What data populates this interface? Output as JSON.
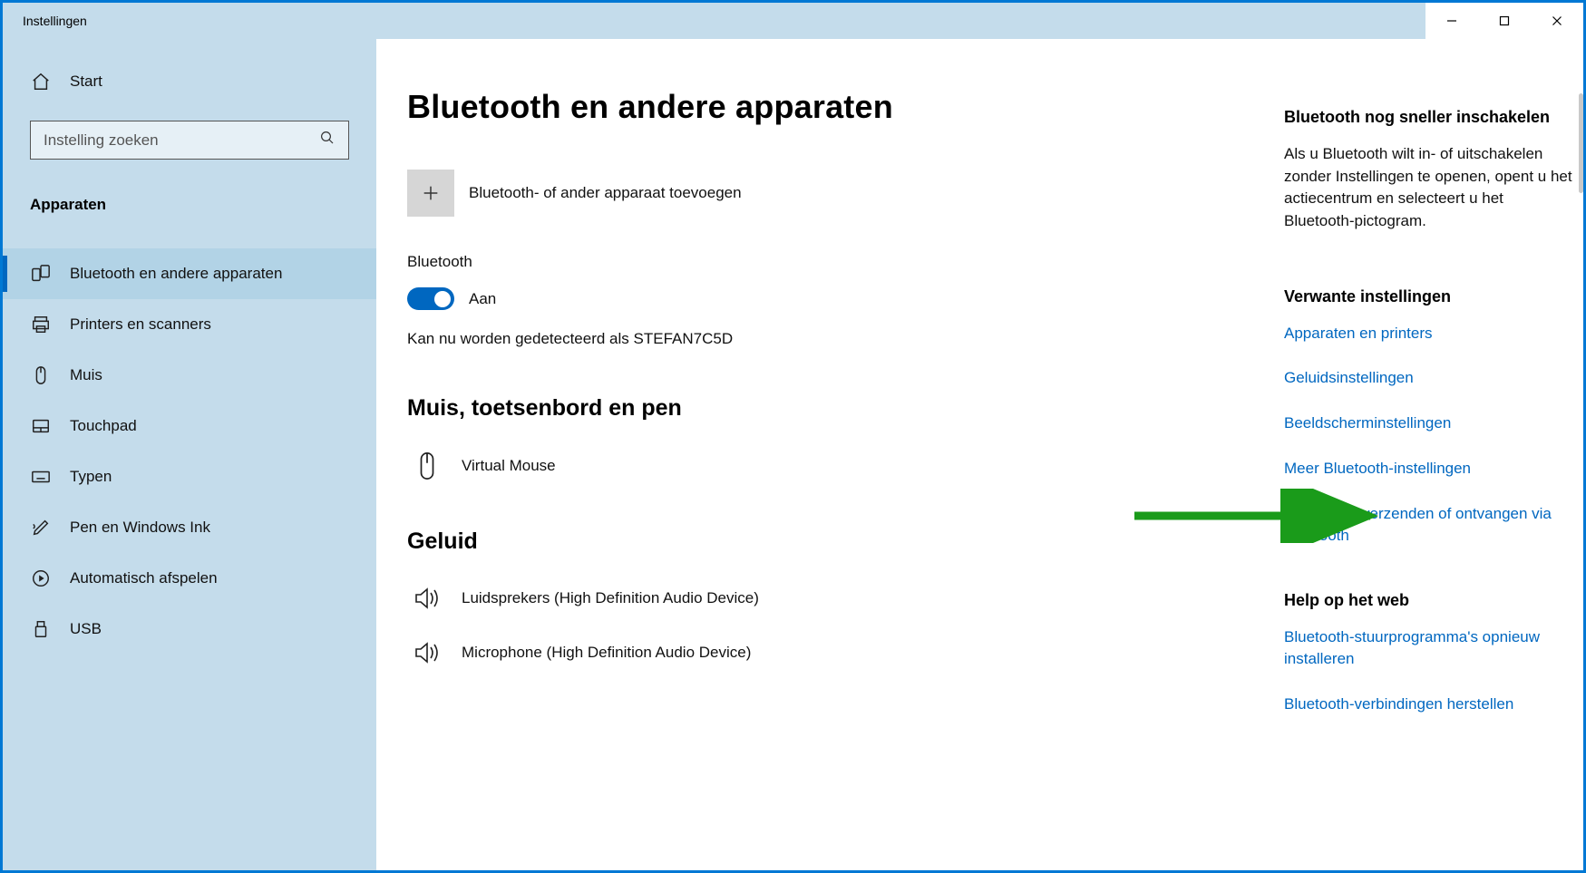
{
  "window": {
    "title": "Instellingen"
  },
  "sidebar": {
    "home": "Start",
    "search_placeholder": "Instelling zoeken",
    "category": "Apparaten",
    "items": [
      {
        "label": "Bluetooth en andere apparaten",
        "icon": "bluetooth-devices"
      },
      {
        "label": "Printers en scanners",
        "icon": "printer"
      },
      {
        "label": "Muis",
        "icon": "mouse"
      },
      {
        "label": "Touchpad",
        "icon": "touchpad"
      },
      {
        "label": "Typen",
        "icon": "keyboard"
      },
      {
        "label": "Pen en Windows Ink",
        "icon": "pen"
      },
      {
        "label": "Automatisch afspelen",
        "icon": "autoplay"
      },
      {
        "label": "USB",
        "icon": "usb"
      }
    ]
  },
  "main": {
    "title": "Bluetooth en andere apparaten",
    "add_device": "Bluetooth- of ander apparaat toevoegen",
    "bluetooth_label": "Bluetooth",
    "toggle_state": "Aan",
    "detectable": "Kan nu worden gedetecteerd als STEFAN7C5D",
    "section_mouse": "Muis, toetsenbord en pen",
    "devices_mouse": [
      {
        "label": "Virtual Mouse",
        "icon": "mouse"
      }
    ],
    "section_audio": "Geluid",
    "devices_audio": [
      {
        "label": "Luidsprekers (High Definition Audio Device)",
        "icon": "speaker"
      },
      {
        "label": "Microphone (High Definition Audio Device)",
        "icon": "speaker"
      }
    ]
  },
  "right": {
    "tip_heading": "Bluetooth nog sneller inschakelen",
    "tip_text": "Als u Bluetooth wilt in- of uitschakelen zonder Instellingen te openen, opent u het actiecentrum en selecteert u het Bluetooth-pictogram.",
    "related_heading": "Verwante instellingen",
    "related_links": [
      "Apparaten en printers",
      "Geluidsinstellingen",
      "Beeldscherminstellingen",
      "Meer Bluetooth-instellingen",
      "Bestanden verzenden of ontvangen via Bluetooth"
    ],
    "help_heading": "Help op het web",
    "help_links": [
      "Bluetooth-stuurprogramma's opnieuw installeren",
      "Bluetooth-verbindingen herstellen"
    ]
  }
}
